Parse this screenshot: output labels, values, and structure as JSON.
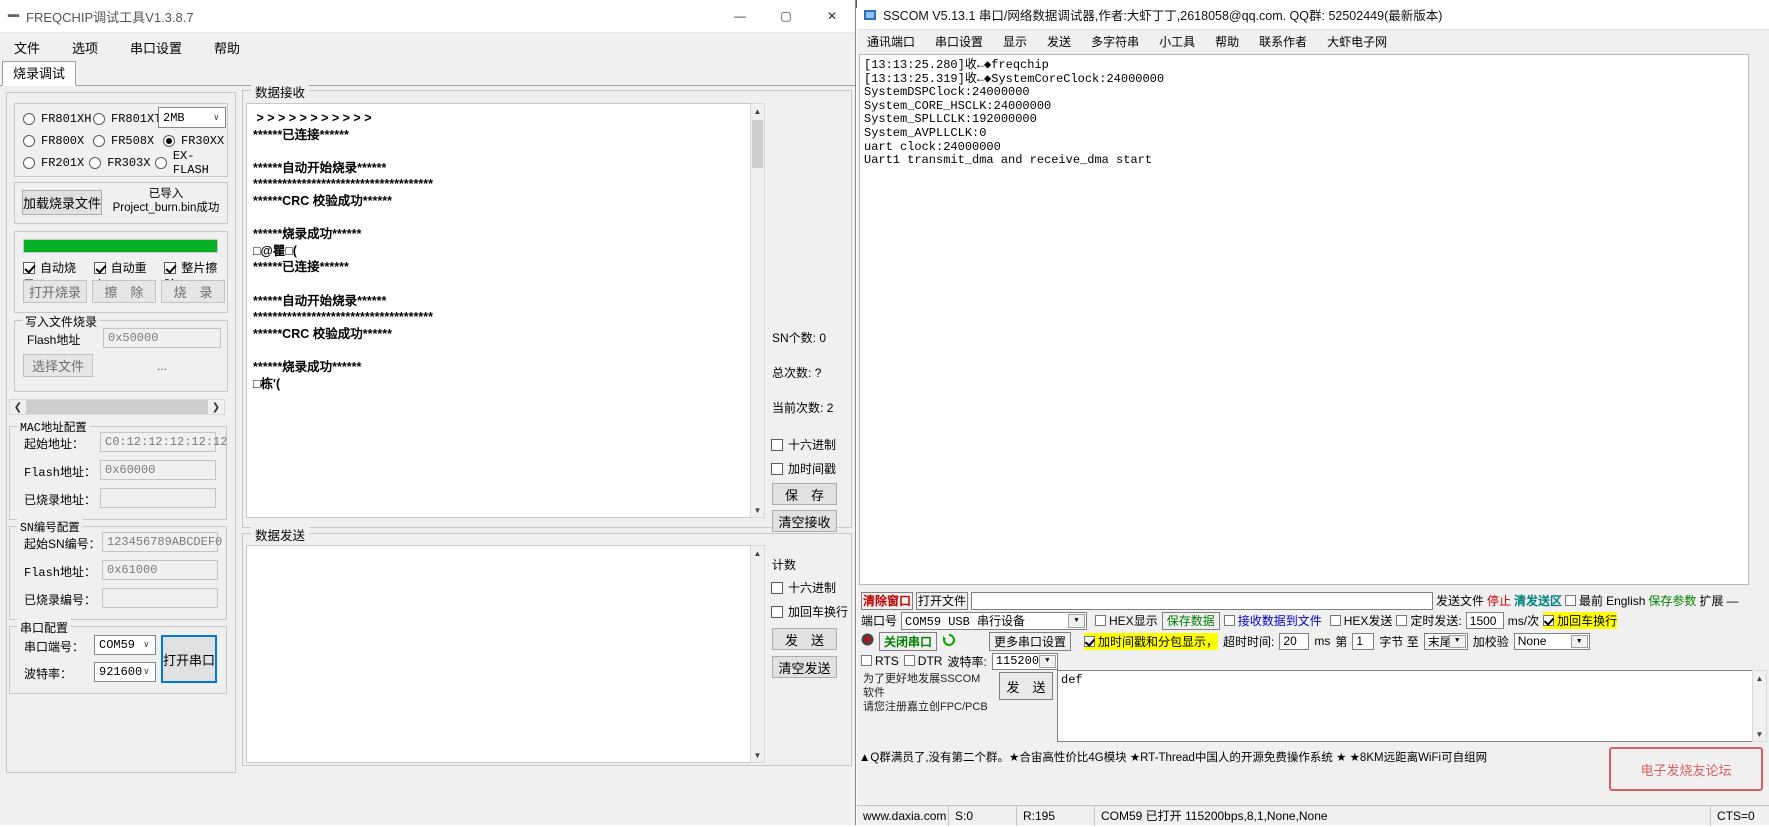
{
  "freqchip": {
    "window_title": "FREQCHIP调试工具V1.3.8.7",
    "win_min": "—",
    "win_max": "▢",
    "win_close": "✕",
    "menu": [
      "文件",
      "选项",
      "串口设置",
      "帮助"
    ],
    "tab": "烧录调试",
    "chips": [
      {
        "label": "FR801XH",
        "selected": false
      },
      {
        "label": "FR801XT",
        "selected": false
      },
      {
        "label": "FR800X",
        "selected": false
      },
      {
        "label": "FR508X",
        "selected": false
      },
      {
        "label": "FR30XX",
        "selected": true
      },
      {
        "label": "FR201X",
        "selected": false
      },
      {
        "label": "FR303X",
        "selected": false
      },
      {
        "label": "EX-FLASH",
        "selected": false
      }
    ],
    "flash_size": "2MB",
    "load_file_button": "加载烧录文件",
    "load_file_status": "已导入Project_burn.bin成功",
    "progress_percent": 100,
    "checks": [
      {
        "label": "自动烧录",
        "checked": true
      },
      {
        "label": "自动重启",
        "checked": true
      },
      {
        "label": "整片擦除",
        "checked": true
      }
    ],
    "action_buttons": [
      "打开烧录",
      "擦　除",
      "烧　录"
    ],
    "write_file_group": {
      "legend": "写入文件烧录",
      "flash_addr_label": "Flash地址",
      "flash_addr_value": "0x50000",
      "select_file_button": "选择文件",
      "file_path": "..."
    },
    "mac_group": {
      "legend": "MAC地址配置",
      "rows": [
        {
          "label": "起始地址：",
          "value": "C0:12:12:12:12:12"
        },
        {
          "label": "Flash地址：",
          "value": "0x60000"
        },
        {
          "label": "已烧录地址：",
          "value": ""
        }
      ]
    },
    "sn_group": {
      "legend": "SN编号配置",
      "rows": [
        {
          "label": "起始SN编号：",
          "value": "123456789ABCDEF0"
        },
        {
          "label": "Flash地址：",
          "value": "0x61000"
        },
        {
          "label": "已烧录编号：",
          "value": ""
        }
      ]
    },
    "serial_group": {
      "legend": "串口配置",
      "port_label": "串口端号：",
      "port_value": "COM59",
      "baud_label": "波特率：",
      "baud_value": "921600",
      "open_button": "打开串口"
    },
    "recv_group": {
      "legend": "数据接收",
      "text": " > > > > > > > > > > >\n******已连接******\n\n******自动开始烧录******\n*************************************\n******CRC 校验成功******\n\n******烧录成功******\n□@瞿□(\n******已连接******\n\n******自动开始烧录******\n*************************************\n******CRC 校验成功******\n\n******烧录成功******\n□栋'("
    },
    "recv_stats": [
      {
        "label": "SN个数:",
        "value": "0"
      },
      {
        "label": "总次数:",
        "value": "?"
      },
      {
        "label": "当前次数:",
        "value": "2"
      }
    ],
    "recv_options": [
      {
        "label": "十六进制",
        "checked": false
      },
      {
        "label": "加时间戳",
        "checked": false
      }
    ],
    "recv_buttons": [
      "保　存",
      "清空接收"
    ],
    "send_group": {
      "legend": "数据发送",
      "text": ""
    },
    "send_panel": {
      "title": "计数",
      "options": [
        {
          "label": "十六进制",
          "checked": false
        },
        {
          "label": "加回车换行",
          "checked": false
        }
      ],
      "buttons": [
        "发　送",
        "清空发送"
      ]
    }
  },
  "sscom": {
    "window_title": "SSCOM V5.13.1 串口/网络数据调试器,作者:大虾丁丁,2618058@qq.com. QQ群: 52502449(最新版本)",
    "menu": [
      "通讯端口",
      "串口设置",
      "显示",
      "发送",
      "多字符串",
      "小工具",
      "帮助",
      "联系作者",
      "大虾电子网"
    ],
    "receive_text": "[13:13:25.280]收←◆freqchip\n[13:13:25.319]收←◆SystemCoreClock:24000000\nSystemDSPClock:24000000\nSystem_CORE_HSCLK:24000000\nSystem_SPLLCLK:192000000\nSystem_AVPLLCLK:0\nuart clock:24000000\nUart1 transmit_dma and receive_dma start",
    "toolbar_row1": {
      "clear_window": "清除窗口",
      "open_file": "打开文件",
      "file_path": "",
      "send_file": "发送文件",
      "stop": "停止",
      "clear_send": "清发送区",
      "topmost": {
        "label": "最前",
        "checked": false
      },
      "english": "English",
      "save_params": "保存参数",
      "extend": "扩展",
      "collapse": "—"
    },
    "toolbar_row2": {
      "port_label": "端口号",
      "port_value": "COM59 USB 串行设备",
      "hex_display": {
        "label": "HEX显示",
        "checked": false
      },
      "save_data": "保存数据",
      "recv_to_file": {
        "label": "接收数据到文件",
        "checked": false
      },
      "hex_send": {
        "label": "HEX发送",
        "checked": false
      },
      "timed_send": {
        "label": "定时发送:",
        "checked": false
      },
      "interval_value": "1500",
      "interval_unit": "ms/次",
      "add_crlf": {
        "label": "加回车换行",
        "checked": true
      }
    },
    "toolbar_row3": {
      "close_port": "关闭串口",
      "more_settings": "更多串口设置",
      "timestamp_split": {
        "label": "加时间戳和分包显示，",
        "checked": true
      },
      "timeout_label": "超时时间:",
      "timeout_value": "20",
      "timeout_unit": "ms",
      "byte_from_label": "第",
      "byte_from_value": "1",
      "byte_mid": "字节 至",
      "byte_to_value": "末尾",
      "checksum_label": "加校验",
      "checksum_value": "None"
    },
    "toolbar_row4": {
      "rts": {
        "label": "RTS",
        "checked": false
      },
      "dtr": {
        "label": "DTR",
        "checked": false
      },
      "baud_label": "波特率:",
      "baud_value": "115200",
      "send_data": "def"
    },
    "promo": {
      "line1": "为了更好地发展SSCOM软件",
      "line2": "请您注册嘉立创FPC/PCB"
    },
    "send_button": "发　送",
    "ad_line1": "▲Q群满员了,没有第二个群。★合宙高性价比4G模块 ★RT-Thread中国人的开源免费操作系统 ★ ★8KM远距离WiFi可自组网",
    "status": {
      "website": "www.daxia.com",
      "sent": "S:0",
      "received": "R:195",
      "port_info": "COM59 已打开  115200bps,8,1,None,None",
      "cts": "CTS=0"
    },
    "watermark": "电子发烧友论坛"
  }
}
